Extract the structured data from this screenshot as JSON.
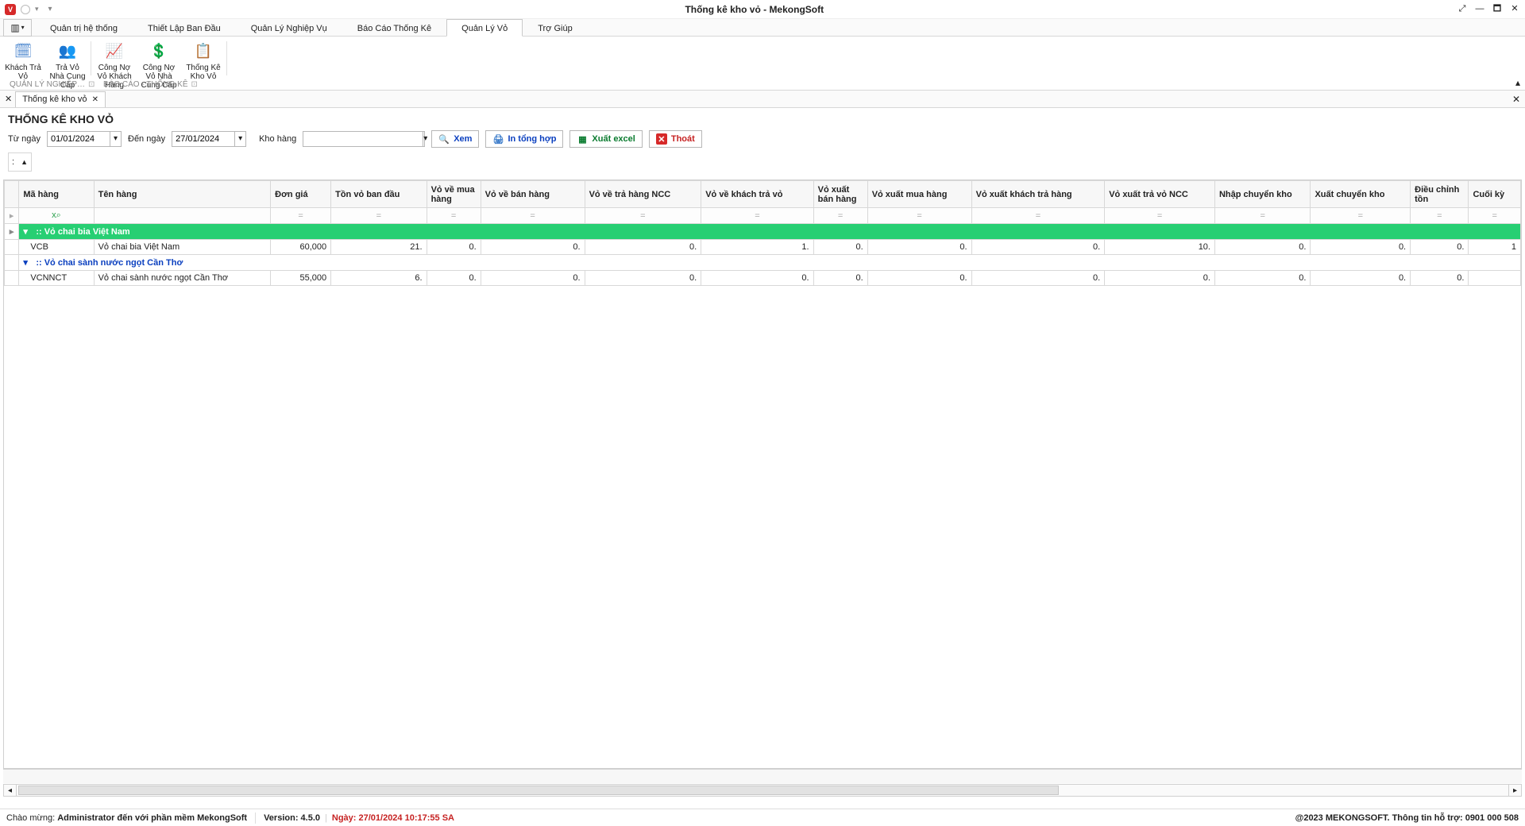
{
  "window": {
    "title": "Thống kê kho vỏ - MekongSoft"
  },
  "menuTabs": {
    "items": [
      {
        "label": "Quản trị hệ thống"
      },
      {
        "label": "Thiết Lập Ban Đầu"
      },
      {
        "label": "Quản Lý Nghiệp Vụ"
      },
      {
        "label": "Báo Cáo Thống Kê"
      },
      {
        "label": "Quản Lý Vỏ"
      },
      {
        "label": "Trợ Giúp"
      }
    ]
  },
  "ribbon": {
    "group1_label": "QUẢN LÝ NGHIỆP…",
    "group2_label": "BÁO CÁO - THỐNG KÊ",
    "items": [
      {
        "label": "Khách Trả Vỏ"
      },
      {
        "label": "Trả Vỏ Nhà Cung Cấp"
      },
      {
        "label": "Công Nợ Vỏ Khách Hàng"
      },
      {
        "label": "Công Nợ Vỏ Nhà Cung Cấp"
      },
      {
        "label": "Thống Kê Kho Vỏ"
      }
    ]
  },
  "docTab": {
    "startClose": "✕",
    "label": "Thống kê kho vỏ",
    "close": "✕"
  },
  "page": {
    "title": "THỐNG KÊ KHO VỎ",
    "fromLabel": "Từ ngày",
    "fromDate": "01/01/2024",
    "toLabel": "Đến ngày",
    "toDate": "27/01/2024",
    "warehouseLabel": "Kho hàng",
    "warehouseValue": "",
    "btnView": "Xem",
    "btnPrint": "In tổng hợp",
    "btnExcel": "Xuất excel",
    "btnExit": "Thoát"
  },
  "pager": {
    "label": ":",
    "arrow": "▲"
  },
  "grid": {
    "headers": [
      "Mã hàng",
      "Tên hàng",
      "Đơn giá",
      "Tồn vỏ ban đầu",
      "Vỏ về mua hàng",
      "Vỏ về bán hàng",
      "Vỏ về trả hàng NCC",
      "Vỏ về khách trả vỏ",
      "Vỏ xuất bán hàng",
      "Vỏ xuất mua hàng",
      "Vỏ xuất khách trả hàng",
      "Vỏ xuất trả vỏ NCC",
      "Nhập chuyển kho",
      "Xuất chuyển kho",
      "Điều chỉnh tồn",
      "Cuối kỳ"
    ],
    "filterIcon": "x⌕",
    "equalsMark": "=",
    "group1": {
      "label": ":: Vỏ chai bia Việt Nam"
    },
    "row1": {
      "code": "VCB",
      "name": "Vỏ chai bia Việt Nam",
      "price": "60,000",
      "start": "21.",
      "in_buy": "0.",
      "in_sell": "0.",
      "in_ret_ncc": "0.",
      "in_cust_ret": "1.",
      "out_sell": "0.",
      "out_buy": "0.",
      "out_cust_ret": "0.",
      "out_ret_ncc": "10.",
      "in_trans": "0.",
      "out_trans": "0.",
      "adj": "0.",
      "end": "1"
    },
    "group2": {
      "label": ":: Vỏ chai sành nước ngọt Cần Thơ"
    },
    "row2": {
      "code": "VCNNCT",
      "name": "Vỏ chai sành nước ngọt Cần Thơ",
      "price": "55,000",
      "start": "6.",
      "in_buy": "0.",
      "in_sell": "0.",
      "in_ret_ncc": "0.",
      "in_cust_ret": "0.",
      "out_sell": "0.",
      "out_buy": "0.",
      "out_cust_ret": "0.",
      "out_ret_ncc": "0.",
      "in_trans": "0.",
      "out_trans": "0.",
      "adj": "0.",
      "end": ""
    }
  },
  "status": {
    "welcome_prefix": "Chào mừng: ",
    "welcome_user": "Administrator đến với phần mềm MekongSoft",
    "version_label": "Version: 4.5.0",
    "date_label": "Ngày: 27/01/2024 10:17:55 SA",
    "right": "@2023 MEKONGSOFT. Thông tin hỗ trợ: 0901 000 508"
  }
}
